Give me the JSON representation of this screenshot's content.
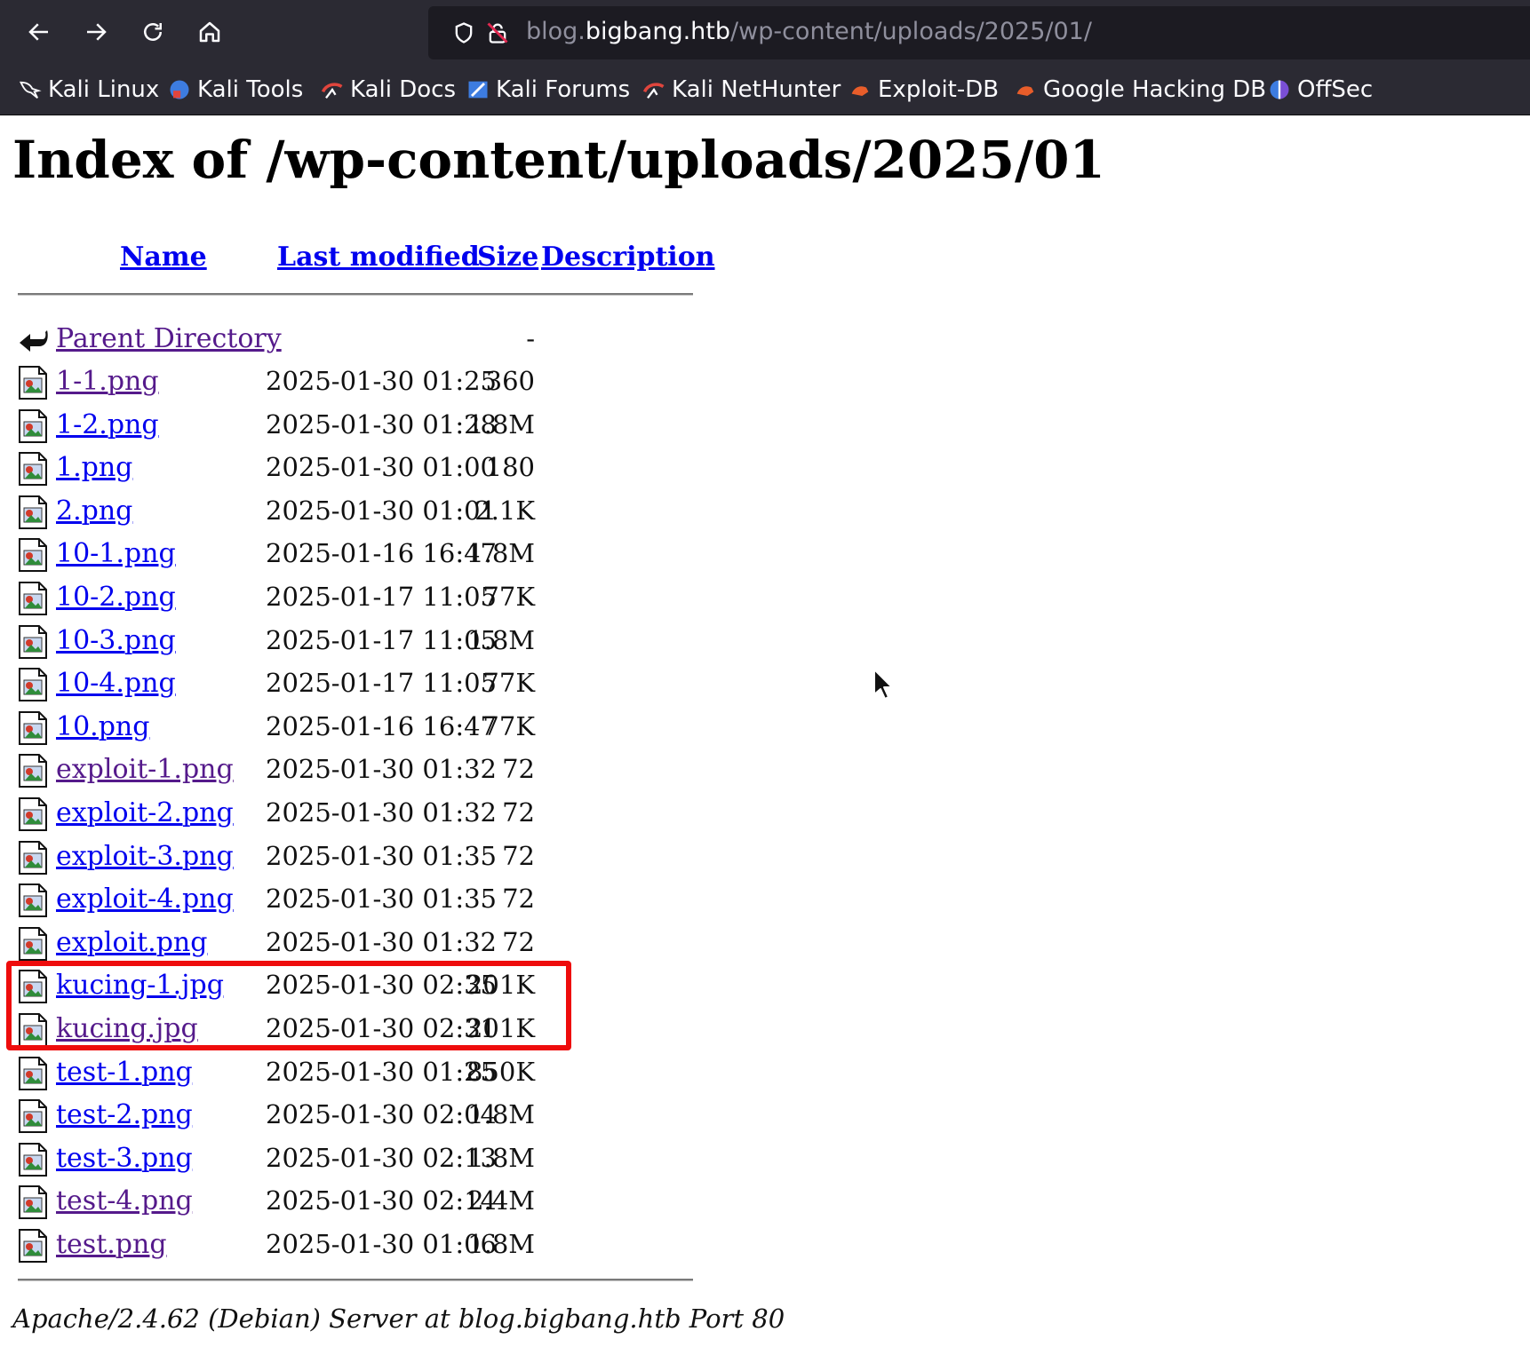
{
  "browser": {
    "url": {
      "scheme_dim": "blog.",
      "host": "bigbang.htb",
      "path": "/wp-content/uploads/2025/01/"
    },
    "bookmarks": [
      {
        "label": "Kali Linux",
        "icon": "kali-dragon-icon"
      },
      {
        "label": "Kali Tools",
        "icon": "kali-tools-icon"
      },
      {
        "label": "Kali Docs",
        "icon": "kali-docs-icon"
      },
      {
        "label": "Kali Forums",
        "icon": "kali-forums-icon"
      },
      {
        "label": "Kali NetHunter",
        "icon": "kali-nethunter-icon"
      },
      {
        "label": "Exploit-DB",
        "icon": "exploit-db-icon"
      },
      {
        "label": "Google Hacking DB",
        "icon": "ghdb-icon"
      },
      {
        "label": "OffSec",
        "icon": "offsec-icon"
      }
    ]
  },
  "page": {
    "title": "Index of /wp-content/uploads/2025/01",
    "columns": {
      "name": "Name",
      "last_modified": "Last modified",
      "size": "Size",
      "description": "Description"
    },
    "parent": {
      "name": "Parent Directory",
      "size": "-"
    },
    "files": [
      {
        "name": "1-1.png",
        "modified": "2025-01-30 01:25",
        "size": "360",
        "visited": true
      },
      {
        "name": "1-2.png",
        "modified": "2025-01-30 01:28",
        "size": "1.8M",
        "visited": false
      },
      {
        "name": "1.png",
        "modified": "2025-01-30 01:00",
        "size": "180",
        "visited": false
      },
      {
        "name": "2.png",
        "modified": "2025-01-30 01:01",
        "size": "2.1K",
        "visited": false
      },
      {
        "name": "10-1.png",
        "modified": "2025-01-16 16:47",
        "size": "1.8M",
        "visited": false
      },
      {
        "name": "10-2.png",
        "modified": "2025-01-17 11:05",
        "size": "77K",
        "visited": false
      },
      {
        "name": "10-3.png",
        "modified": "2025-01-17 11:05",
        "size": "1.8M",
        "visited": false
      },
      {
        "name": "10-4.png",
        "modified": "2025-01-17 11:05",
        "size": "77K",
        "visited": false
      },
      {
        "name": "10.png",
        "modified": "2025-01-16 16:47",
        "size": "77K",
        "visited": false
      },
      {
        "name": "exploit-1.png",
        "modified": "2025-01-30 01:32",
        "size": "72",
        "visited": true
      },
      {
        "name": "exploit-2.png",
        "modified": "2025-01-30 01:32",
        "size": "72",
        "visited": false
      },
      {
        "name": "exploit-3.png",
        "modified": "2025-01-30 01:35",
        "size": "72",
        "visited": false
      },
      {
        "name": "exploit-4.png",
        "modified": "2025-01-30 01:35",
        "size": "72",
        "visited": false
      },
      {
        "name": "exploit.png",
        "modified": "2025-01-30 01:32",
        "size": "72",
        "visited": false
      },
      {
        "name": "kucing-1.jpg",
        "modified": "2025-01-30 02:35",
        "size": "201K",
        "visited": false
      },
      {
        "name": "kucing.jpg",
        "modified": "2025-01-30 02:31",
        "size": "201K",
        "visited": true
      },
      {
        "name": "test-1.png",
        "modified": "2025-01-30 01:25",
        "size": "850K",
        "visited": false
      },
      {
        "name": "test-2.png",
        "modified": "2025-01-30 02:04",
        "size": "1.8M",
        "visited": false
      },
      {
        "name": "test-3.png",
        "modified": "2025-01-30 02:13",
        "size": "1.8M",
        "visited": false
      },
      {
        "name": "test-4.png",
        "modified": "2025-01-30 02:14",
        "size": "2.4M",
        "visited": true
      },
      {
        "name": "test.png",
        "modified": "2025-01-30 01:06",
        "size": "1.8M",
        "visited": true
      }
    ],
    "footer": "Apache/2.4.62 (Debian) Server at blog.bigbang.htb Port 80"
  },
  "annotation": {
    "highlight_color": "#ee0c0c"
  },
  "colors": {
    "link": "#0000ee",
    "visited": "#551a8b",
    "chrome": "#2b2a33"
  }
}
